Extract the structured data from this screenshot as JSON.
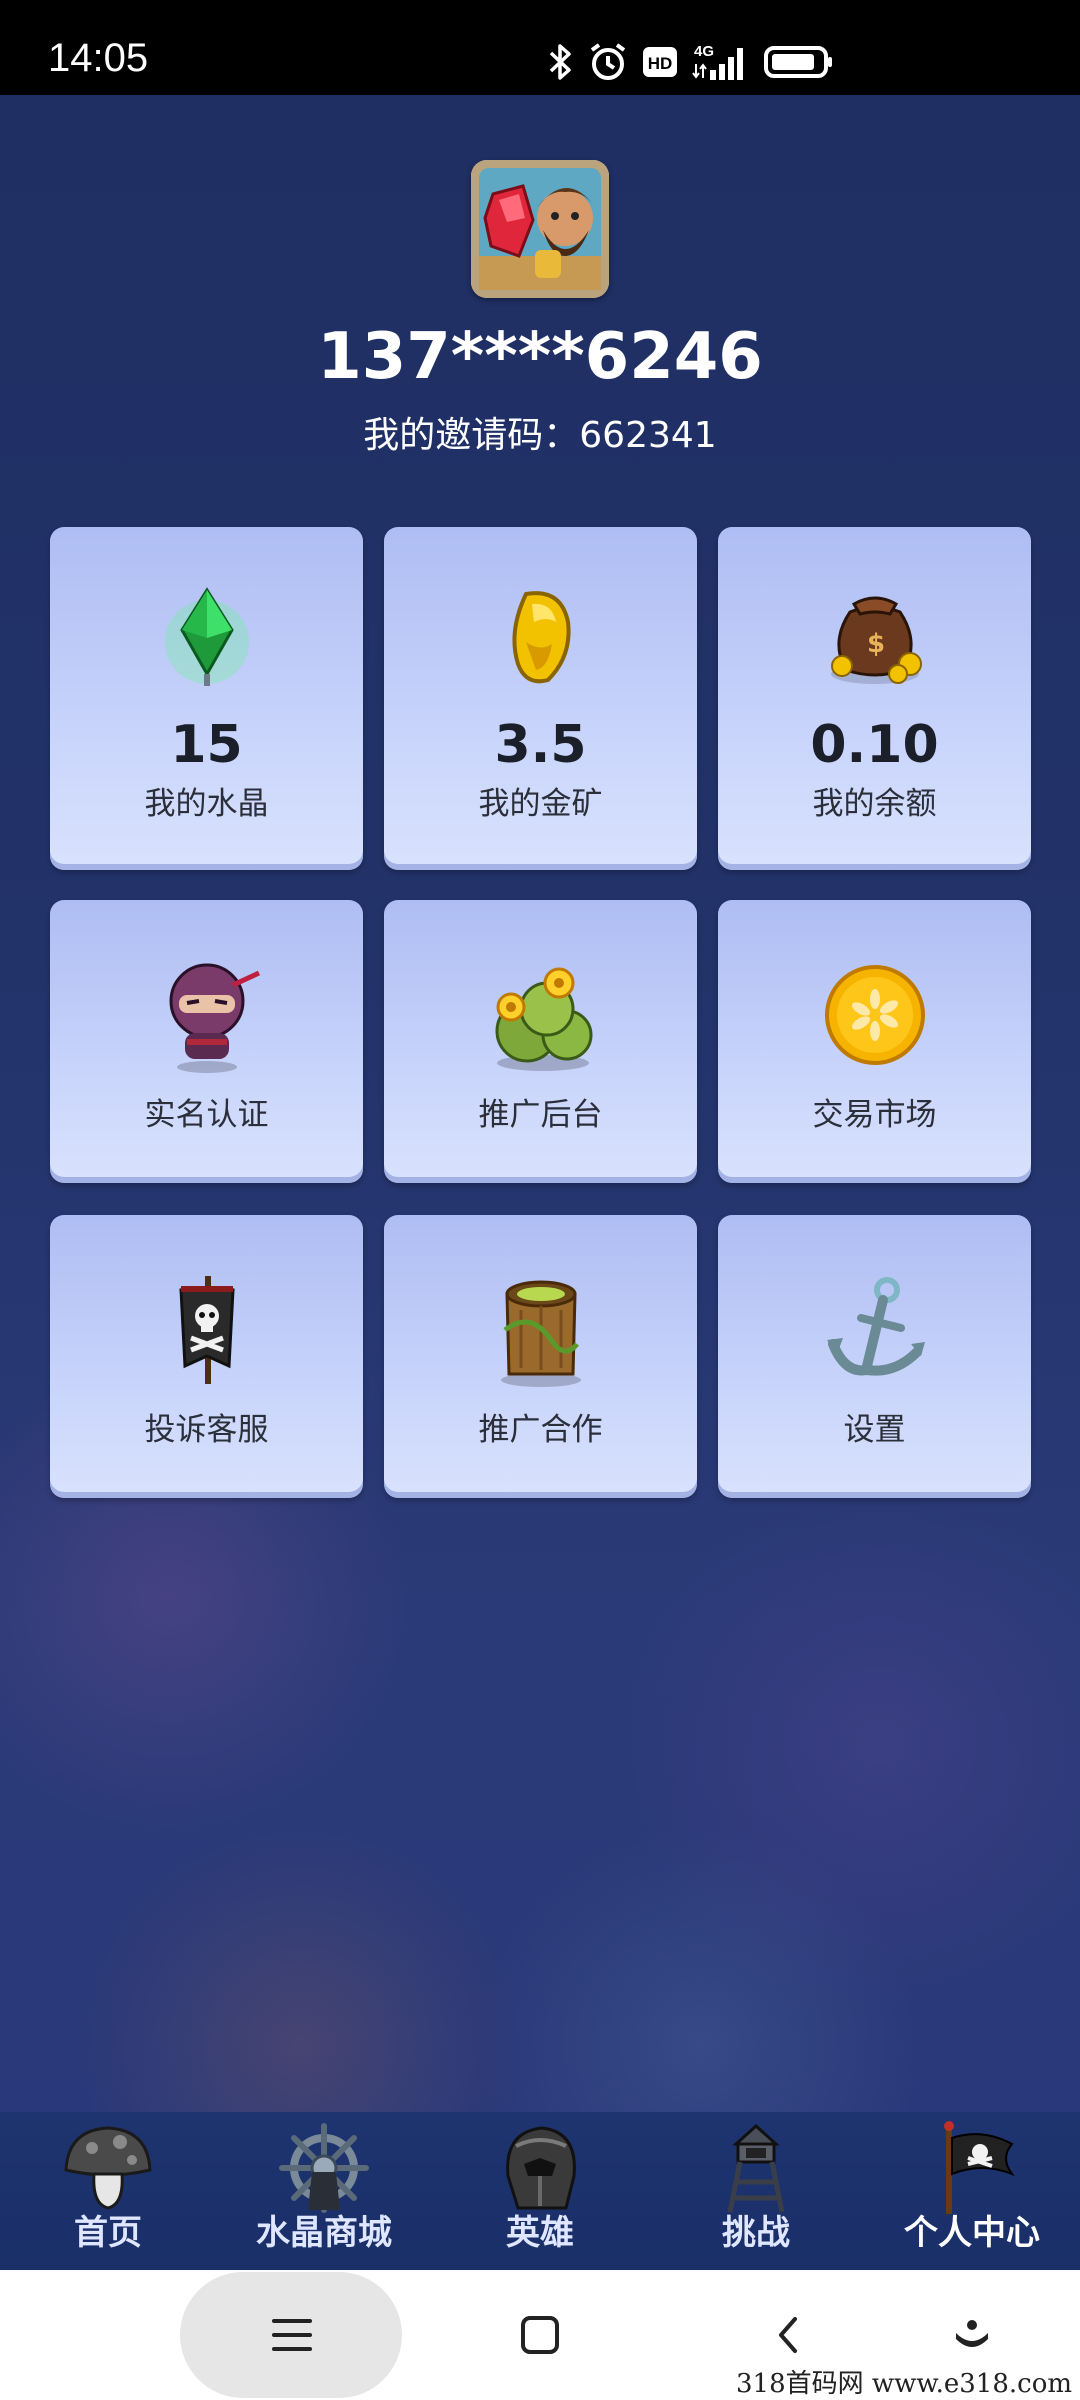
{
  "status_bar": {
    "time": "14:05",
    "network": "4G",
    "hd_label": "HD",
    "icons": [
      "bluetooth-icon",
      "alarm-icon",
      "hd-icon",
      "signal-icon",
      "battery-icon"
    ]
  },
  "profile": {
    "phone": "137****6246",
    "invite_text": "我的邀请码：662341"
  },
  "stats": [
    {
      "value": "15",
      "label": "我的水晶",
      "icon": "crystal-icon"
    },
    {
      "value": "3.5",
      "label": "我的金矿",
      "icon": "gold-nugget-icon"
    },
    {
      "value": "0.10",
      "label": "我的余额",
      "icon": "money-bag-icon"
    }
  ],
  "menu": [
    {
      "label": "实名认证",
      "icon": "ninja-icon"
    },
    {
      "label": "推广后台",
      "icon": "flower-bush-icon"
    },
    {
      "label": "交易市场",
      "icon": "gold-coin-icon"
    },
    {
      "label": "投诉客服",
      "icon": "pirate-flag-icon"
    },
    {
      "label": "推广合作",
      "icon": "tree-stump-icon"
    },
    {
      "label": "设置",
      "icon": "anchor-icon"
    }
  ],
  "bottom_nav": [
    {
      "label": "首页",
      "icon": "mushroom-icon",
      "active": false
    },
    {
      "label": "水晶商城",
      "icon": "ship-wheel-icon",
      "active": false
    },
    {
      "label": "英雄",
      "icon": "helmet-icon",
      "active": false
    },
    {
      "label": "挑战",
      "icon": "watchtower-icon",
      "active": false
    },
    {
      "label": "个人中心",
      "icon": "pirate-flag-icon",
      "active": true
    }
  ],
  "system_nav": [
    "menu-icon",
    "home-square-icon",
    "back-icon",
    "assistant-icon"
  ],
  "watermark": "318首码网  www.e318.com"
}
